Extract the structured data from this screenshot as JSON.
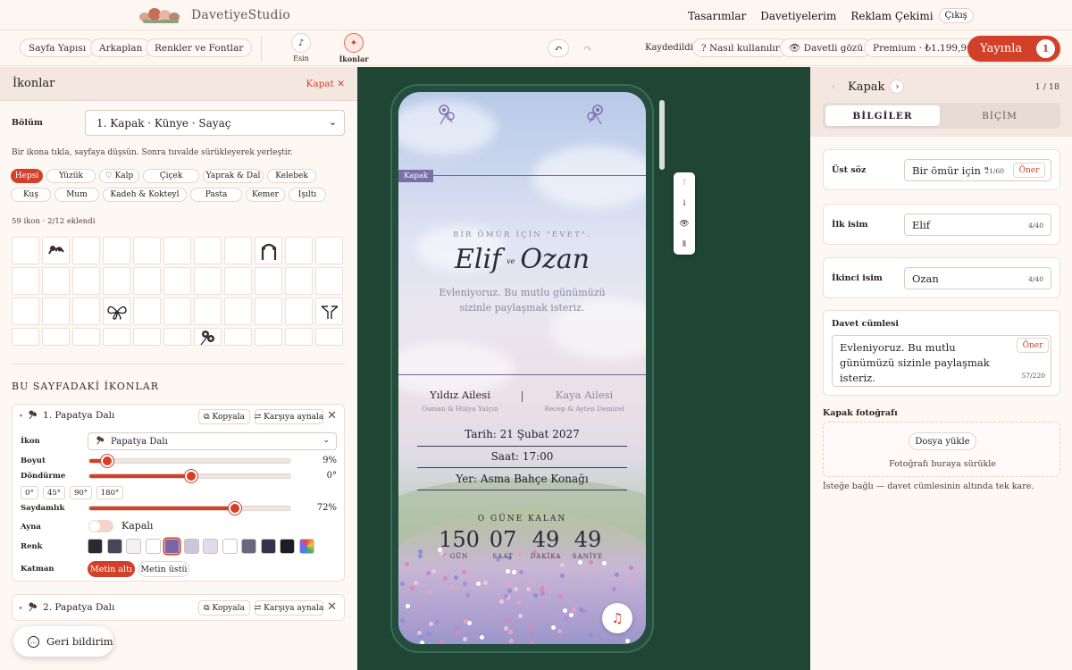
{
  "brand": {
    "name": "DavetiyeStudio"
  },
  "nav": {
    "links": [
      "Tasarımlar",
      "Davetiyelerim",
      "Reklam Çekimi"
    ],
    "logout": "Çıkış"
  },
  "toolbar": {
    "tabs": [
      "Sayfa Yapısı",
      "Arkaplan",
      "Renkler ve Fontlar"
    ],
    "modes": [
      {
        "label": "Esin",
        "icon": "music-note-icon"
      },
      {
        "label": "İkonlar",
        "icon": "sparkle-icon"
      }
    ],
    "undo": "↶",
    "redo": "↷",
    "saved": "Kaydedildi",
    "how_to": "? Nasıl kullanılır",
    "guest_view": "👁 Davetli gözü",
    "premium": "Premium · ₺1.199,90",
    "publish": "Yayınla",
    "publish_badge": "1"
  },
  "left": {
    "title": "İkonlar",
    "close": "Kapat ✕",
    "section_label": "Bölüm",
    "section_value": "1. Kapak · Künye · Sayaç",
    "hint": "Bir ikona tıkla, sayfaya düşsün. Sonra tuvalde sürükleyerek yerleştir.",
    "chips": [
      "Hepsi",
      "Yüzük",
      "♡ Kalp",
      "Çiçek",
      "Yaprak & Dal",
      "Kelebek",
      "Kuş",
      "Mum",
      "Kadeh & Kokteyl",
      "Pasta",
      "Kemer",
      "Işıltı"
    ],
    "count": "59 ikon · 2/12 eklendi",
    "placed_title": "BU SAYFADAKİ İKONLAR",
    "card1": {
      "title": "1. Papatya Dalı",
      "copy": "Kopyala",
      "mirror": "Karşıya aynala",
      "ikon_label": "İkon",
      "ikon_value": "Papatya Dalı",
      "size_label": "Boyut",
      "size_value": "9%",
      "size_pct": 9,
      "rotate_label": "Döndürme",
      "rotate_value": "0°",
      "rotate_pct": 50,
      "deg_buttons": [
        "0°",
        "45°",
        "90°",
        "180°"
      ],
      "opacity_label": "Saydamlık",
      "opacity_value": "72%",
      "opacity_pct": 72,
      "mirror_label": "Ayna",
      "mirror_state": "Kapalı",
      "color_label": "Renk",
      "colors": [
        "#2b2a33",
        "#4a4458",
        "#f4f1f4",
        "#ffffff",
        "#7a65a8",
        "#cdc5dc",
        "#e0dcea",
        "#ffffff",
        "#6b6680",
        "#35334a",
        "#1c1c22",
        "multicolor"
      ],
      "layer_label": "Katman",
      "layer_options": [
        "Metin altı",
        "Metin üstü"
      ]
    },
    "card2": {
      "title": "2. Papatya Dalı",
      "copy": "Kopyala",
      "mirror": "Karşıya aynala"
    },
    "feedback": "Geri bildirim"
  },
  "invite": {
    "tag": "Kapak",
    "upper": "BİR ÖMÜR İÇİN \"EVET\".",
    "name1": "Elif",
    "ve": "ve",
    "name2": "Ozan",
    "message": "Evleniyoruz. Bu mutlu günümüzü sizinle paylaşmak isteriz.",
    "family1": "Yıldız Ailesi",
    "family1_sub": "Osman & Hülya Yalçın",
    "family2": "Kaya Ailesi",
    "family2_sub": "Recep & Ayten Demirel",
    "date_label": "Tarih:",
    "date": "21 Şubat 2027",
    "time_label": "Saat:",
    "time": "17:00",
    "place_label": "Yer:",
    "place": "Asma Bahçe Konağı",
    "countdown_title": "O GÜNE KALAN",
    "countdown": [
      {
        "value": "150",
        "unit": "GÜN"
      },
      {
        "value": "07",
        "unit": "SAAT"
      },
      {
        "value": "49",
        "unit": "DAKİKA"
      },
      {
        "value": "49",
        "unit": "SANİYE"
      }
    ]
  },
  "right": {
    "page_name": "Kapak",
    "page_count": "1 / 18",
    "tab_active": "BİLGİLER",
    "tab_inactive": "BİÇİM",
    "fields": [
      {
        "label": "Üst söz",
        "value": "Bir ömür için \"",
        "counter": "21/60",
        "suggest": "Öner"
      },
      {
        "label": "İlk isim",
        "value": "Elif",
        "counter": "4/40"
      },
      {
        "label": "İkinci isim",
        "value": "Ozan",
        "counter": "4/40"
      }
    ],
    "message_label": "Davet cümlesi",
    "message_value": "Evleniyoruz. Bu mutlu günümüzü sizinle paylaşmak isteriz.",
    "message_counter": "57/220",
    "message_suggest": "Öner",
    "photo_label": "Kapak fotoğrafı",
    "upload_btn": "Dosya yükle",
    "upload_hint": "Fotoğrafı buraya sürükle",
    "note": "İsteğe bağlı — davet cümlesinin altında tek kare."
  }
}
